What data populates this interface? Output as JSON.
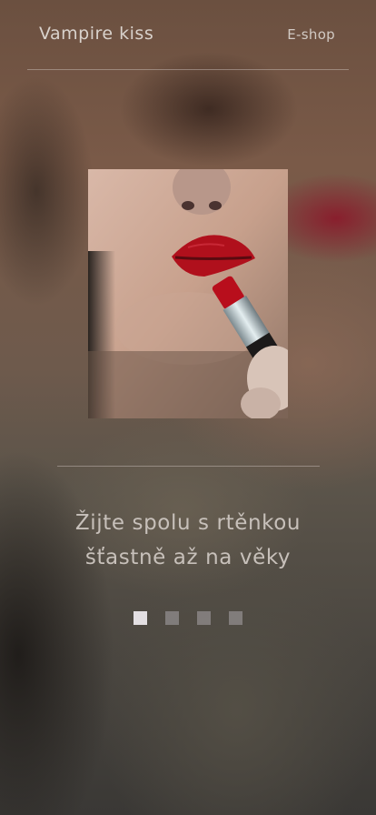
{
  "header": {
    "brand": "Vampire kiss",
    "nav_link": "E-shop"
  },
  "hero": {
    "tagline_line1": "Žijte spolu s rtěnkou",
    "tagline_line2": "šťastně až na věky"
  },
  "slider": {
    "total_slides": 4,
    "active_index": 0
  },
  "colors": {
    "lipstick_red": "#b0101c",
    "text_light": "#d9d2cc",
    "dot_active": "#e3dfe2"
  }
}
